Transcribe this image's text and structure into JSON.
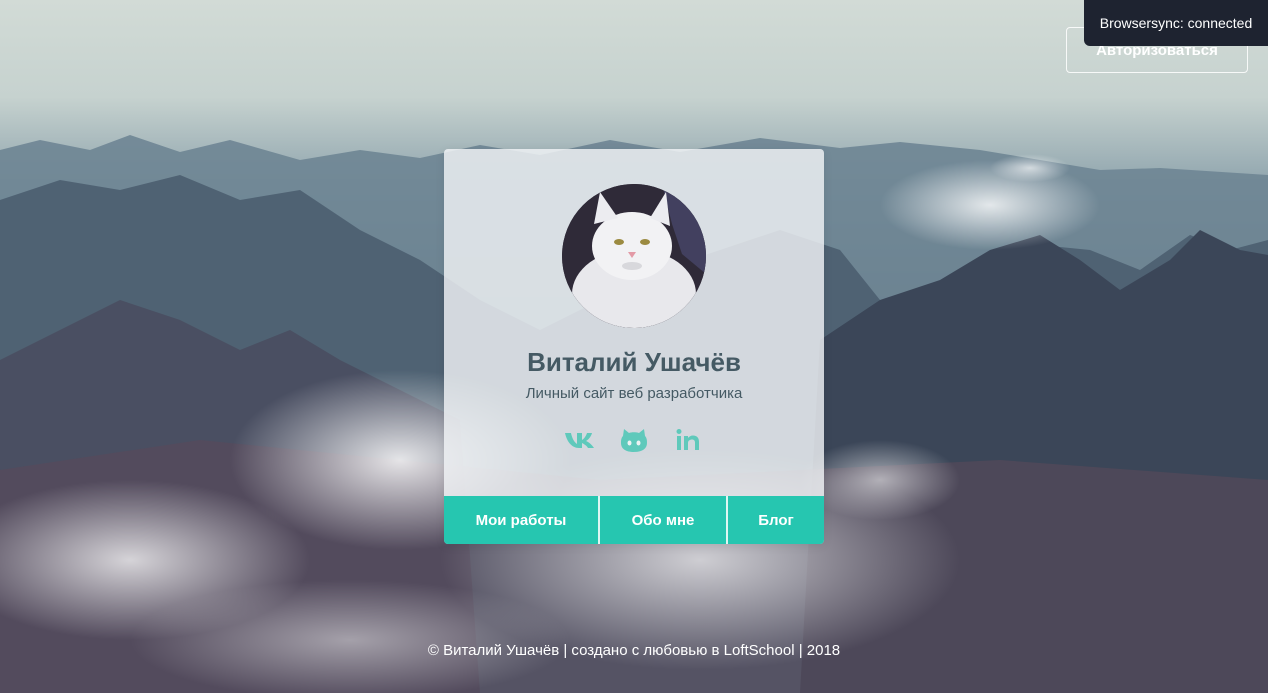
{
  "header": {
    "auth_label": "Авторизоваться",
    "browsersync_toast": "Browsersync: connected"
  },
  "profile": {
    "name": "Виталий Ушачёв",
    "subtitle": "Личный сайт веб разработчика",
    "avatar_alt": "cat-avatar"
  },
  "socials": [
    {
      "icon": "vk-icon"
    },
    {
      "icon": "github-icon"
    },
    {
      "icon": "linkedin-icon"
    }
  ],
  "nav": {
    "works_label": "Мои работы",
    "about_label": "Обо мне",
    "blog_label": "Блог"
  },
  "footer": {
    "text": "© Виталий Ушачёв | создано с любовью в LoftSchool | 2018"
  },
  "colors": {
    "accent": "#26c6b0",
    "text_dark": "#455a64",
    "toast_bg": "#1e2330"
  }
}
